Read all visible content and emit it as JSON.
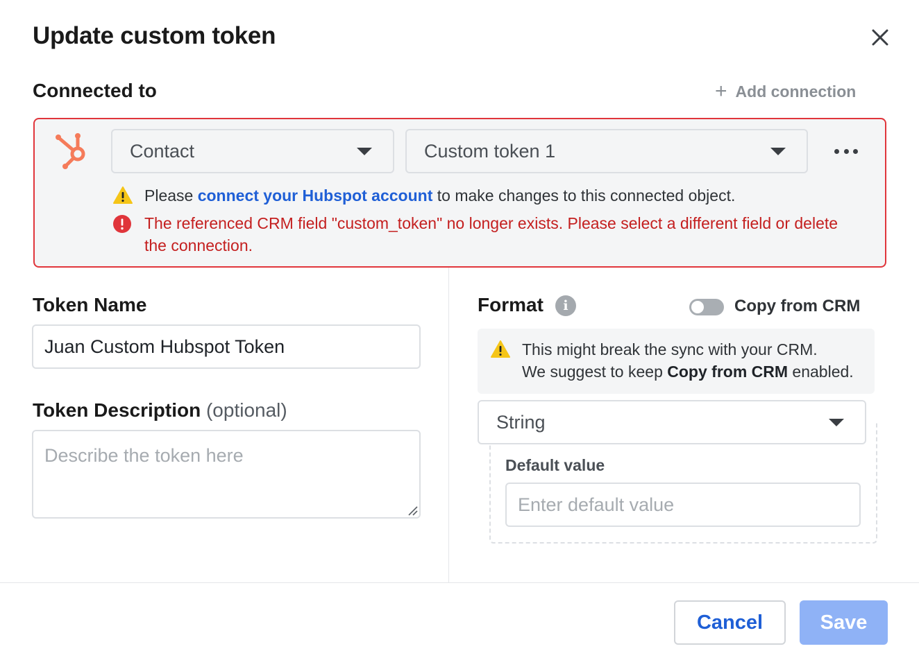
{
  "dialog": {
    "title": "Update custom token"
  },
  "connected": {
    "label": "Connected to",
    "add_connection_label": "Add connection",
    "object_select_value": "Contact",
    "field_select_value": "Custom token 1",
    "warning": {
      "prefix": "Please ",
      "link": "connect your Hubspot account",
      "suffix": " to make changes to this connected object."
    },
    "error": "The referenced CRM field \"custom_token\" no longer exists. Please select a different field or delete the connection."
  },
  "token_name": {
    "label": "Token Name",
    "value": "Juan Custom Hubspot Token"
  },
  "token_description": {
    "label": "Token Description",
    "optional": "(optional)",
    "placeholder": "Describe the token here"
  },
  "format": {
    "label": "Format",
    "info_glyph": "i",
    "toggle_label": "Copy from CRM",
    "toggle_on": false,
    "warning_line1": "This might break the sync with your CRM.",
    "warning_line2_prefix": "We suggest to keep ",
    "warning_line2_bold": "Copy from CRM",
    "warning_line2_suffix": " enabled.",
    "type_value": "String",
    "default_label": "Default value",
    "default_placeholder": "Enter default value"
  },
  "footer": {
    "cancel_label": "Cancel",
    "save_label": "Save"
  },
  "colors": {
    "error_red": "#e0353b",
    "link_blue": "#1f5fd6",
    "warning_yellow": "#f5c518",
    "hubspot_orange": "#f57b5a",
    "save_disabled_blue": "#8fb2f6"
  },
  "icons": {
    "close": "close-icon",
    "hubspot": "hubspot-logo-icon",
    "more": "more-horizontal-icon",
    "warning": "warning-triangle-icon",
    "error": "error-circle-icon",
    "info": "info-icon",
    "plus": "plus-icon",
    "caret": "chevron-down-icon"
  }
}
